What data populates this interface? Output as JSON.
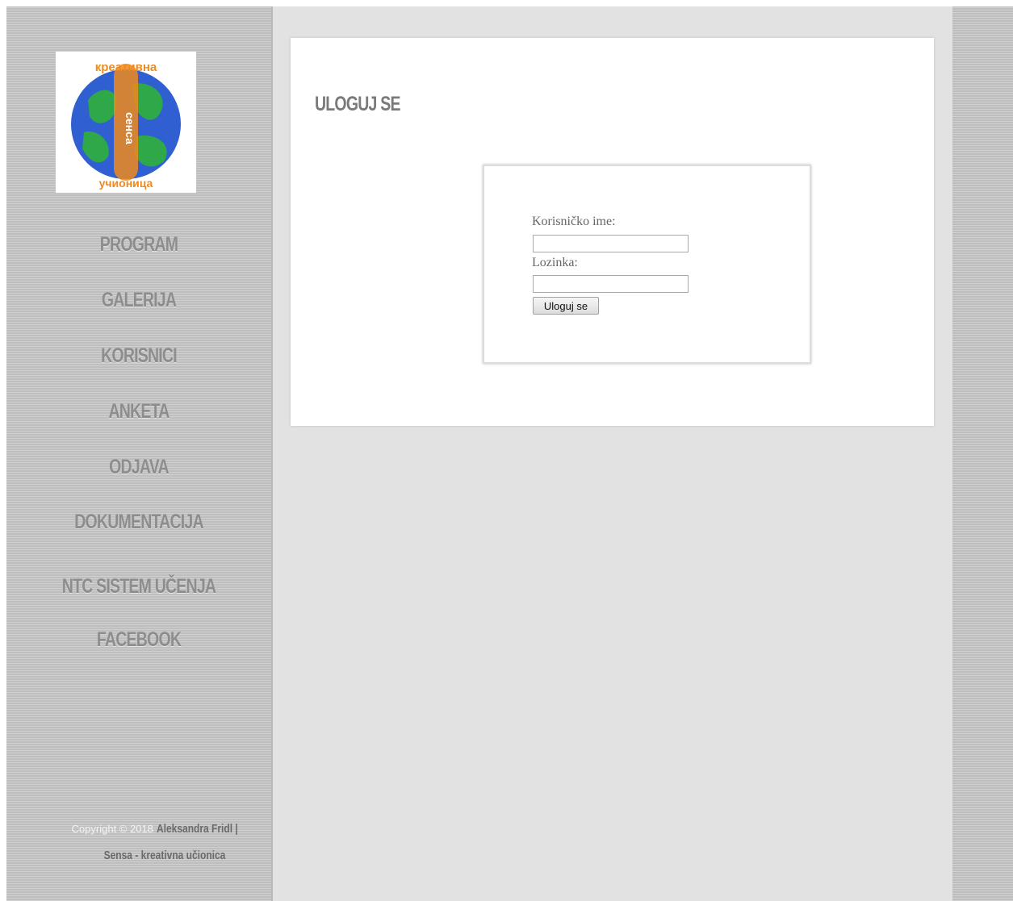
{
  "logo": {
    "top_text": "креативна",
    "center_text": "сенса",
    "bottom_text": "учионица",
    "colors": {
      "ocean": "#2f5fd0",
      "land": "#2fa84a",
      "text": "#f08a1c"
    }
  },
  "nav": {
    "items": [
      {
        "label": "PROGRAM"
      },
      {
        "label": "GALERIJA"
      },
      {
        "label": "KORISNICI"
      },
      {
        "label": "ANKETA"
      },
      {
        "label": "ODJAVA"
      },
      {
        "label": "DOKUMENTACIJA"
      },
      {
        "label": "NTC SISTEM UČENJA"
      },
      {
        "label": "FACEBOOK"
      }
    ]
  },
  "footer": {
    "copyright": "Copyright © 2018",
    "author": "Aleksandra Fridl |",
    "site": "Sensa - kreativna učionica"
  },
  "main": {
    "title": "ULOGUJ SE",
    "form": {
      "username_label": "Korisničko ime:",
      "username_value": "",
      "password_label": "Lozinka:",
      "password_value": "",
      "submit_label": "Uloguj se"
    }
  },
  "colors": {
    "sidebar_bg": "#c6c6c6",
    "content_bg": "#e2e2e2",
    "nav_text": "#8d8d8d"
  }
}
